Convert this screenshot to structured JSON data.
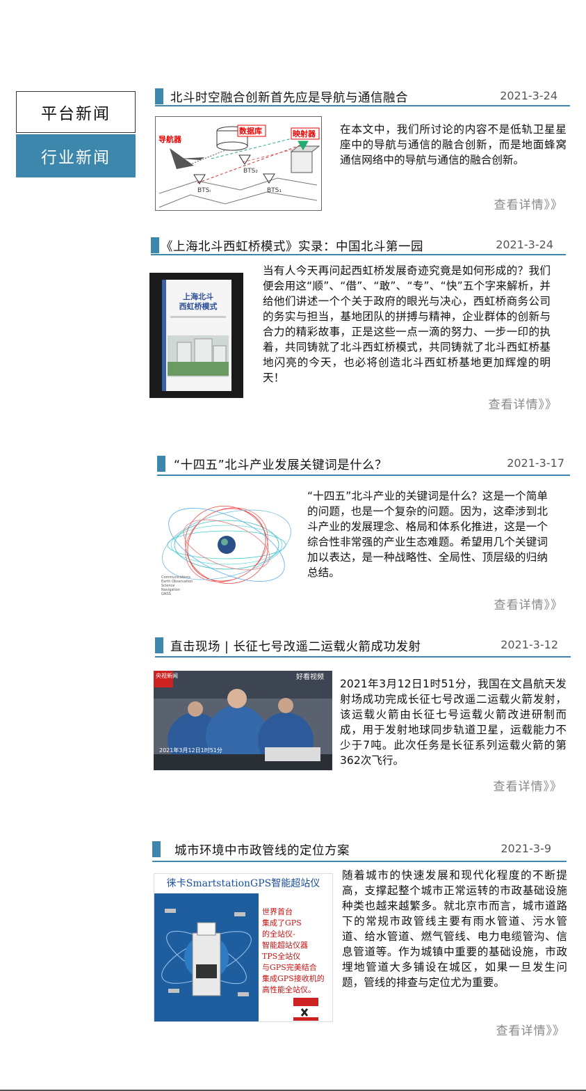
{
  "sidebar": {
    "tabs": [
      {
        "label": "平台新闻",
        "active": false
      },
      {
        "label": "行业新闻",
        "active": true
      }
    ],
    "accent_color": "#3d87ad"
  },
  "articles": [
    {
      "title": "北斗时空融合创新首先应是导航与通信融合",
      "date": "2021-3-24",
      "body": "在本文中，我们所讨论的内容不是低轨卫星星座中的导航与通信的融合创新，而是地面蜂窝通信网络中的导航与通信的融合创新。",
      "more": "查看详情》》",
      "image_labels": {
        "nav": "导航器",
        "db": "数据库",
        "mapper": "映射器",
        "bts2": "BTS₂",
        "bts1": "BTS₁",
        "btsi": "BTSᵢ"
      }
    },
    {
      "title": "《上海北斗西虹桥模式》实录：中国北斗第一园",
      "date": "2021-3-24",
      "body": "当有人今天再问起西虹桥发展奇迹究竟是如何形成的？我们便会用这“顺”、“借”、“敢”、“专”、“快”五个字来解析，并给他们讲述一个个关于政府的眼光与决心，西虹桥商务公司的务实与担当，基地团队的拼搏与精神，企业群体的创新与合力的精彩故事，正是这些一点一滴的努力、一步一印的执着，共同铸就了北斗西虹桥模式，共同铸就了北斗西虹桥基地闪亮的今天，也必将创造北斗西虹桥基地更加辉煌的明天！",
      "more": "查看详情》》",
      "image_labels": {
        "book_title_1": "上海北斗",
        "book_title_2": "西虹桥模式"
      }
    },
    {
      "title": "“十四五”北斗产业发展关键词是什么？",
      "date": "2021-3-17",
      "body": "“十四五”北斗产业的关键词是什么？这是一个简单的问题，也是一个复杂的问题。因为，这牵涉到北斗产业的发展理念、格局和体系化推进，这是一个综合性非常强的产业生态难题。希望用几个关键词加以表达，是一种战略性、全局性、顶层级的归纳总结。",
      "more": "查看详情》》",
      "image_labels": {
        "legend": [
          "Communications",
          "Earth Observation",
          "Science",
          "Navigation",
          "GNSS"
        ]
      }
    },
    {
      "title": "直击现场 | 长征七号改遥二运载火箭成功发射",
      "date": "2021-3-12",
      "body": "2021年3月12日1时51分，我国在文昌航天发射场成功完成长征七号改遥二运载火箭发射，该运载火箭由长征七号运载火箭改进研制而成，用于发射地球同步轨道卫星，运载能力不少于7吨。此次任务是长征系列运载火箭的第362次飞行。",
      "more": "查看详情》》",
      "image_labels": {
        "badge": "央视新闻",
        "video": "好看视频",
        "time": "2021年3月12日1时51分"
      }
    },
    {
      "title": "城市环境中市政管线的定位方案",
      "date": "2021-3-9",
      "body": "随着城市的快速发展和现代化程度的不断提高，支撑起整个城市正常运转的市政基础设施种类也越来越繁多。就北京市而言，城市道路下的常规市政管线主要有雨水管道、污水管道、给水管道、燃气管线、电力电缆管沟、信息管道等。作为城镇中重要的基础设施，市政埋地管道大多铺设在城区，如果一旦发生问题，管线的排查与定位尤为重要。",
      "more": "查看详情》》",
      "image_labels": {
        "heading": "徕卡SmartstationGPS智能超站仪",
        "lines": [
          "世界首台",
          "集成了GPS",
          "的全站仪-",
          "智能超站仪器",
          "TPS全站仪",
          "与GPS完美结合",
          "集成GPS接收机的",
          "高性能全站仪。"
        ]
      }
    }
  ]
}
